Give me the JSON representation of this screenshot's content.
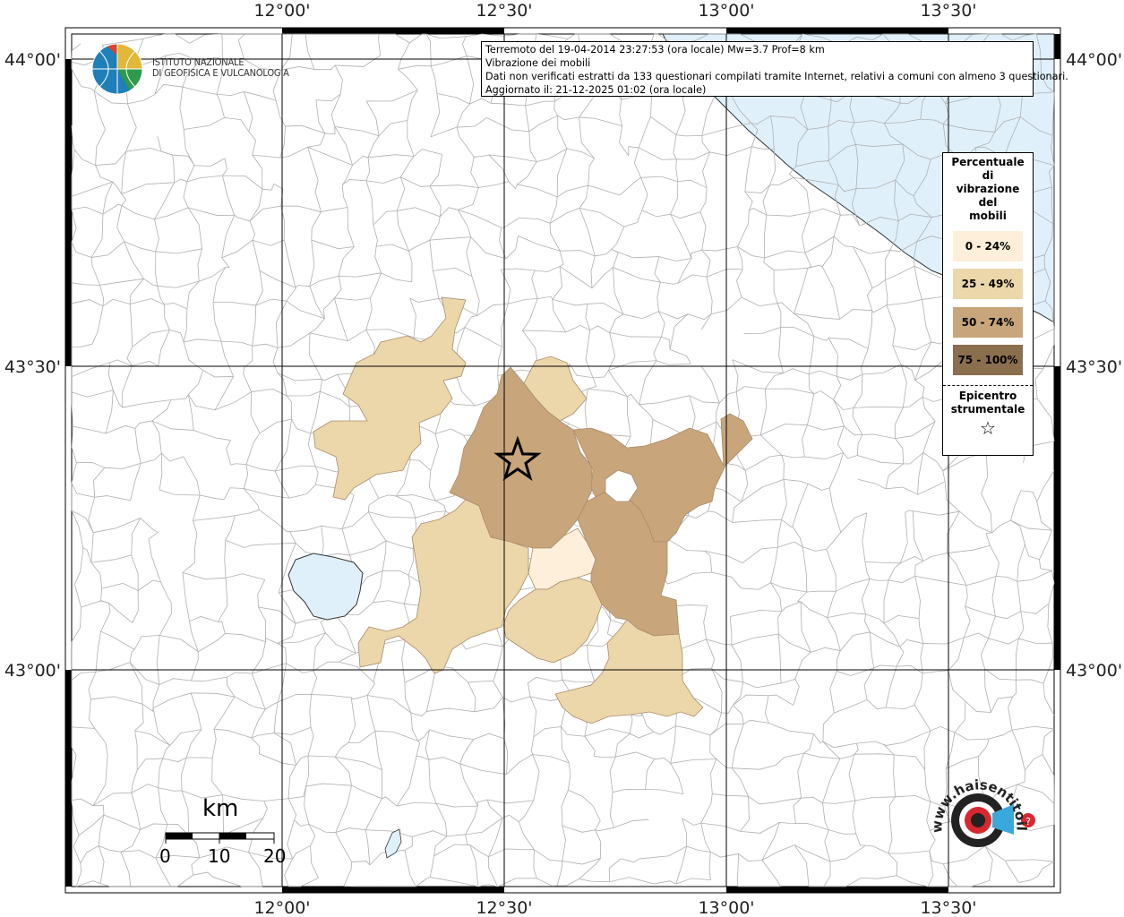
{
  "info": {
    "line1": "Terremoto del 19-04-2014 23:27:53 (ora locale) Mw=3.7 Prof=8 km",
    "line2": "Vibrazione dei mobili",
    "line3": "Dati non verificati estratti da 133 questionari compilati tramite Internet, relativi a comuni con almeno 3 questionari.",
    "line4": "Aggiornato il: 21-12-2025 01:02 (ora locale)"
  },
  "logo": {
    "line1": "ISTITUTO NAZIONALE",
    "line2": "DI GEOFISICA E VULCANOLOGIA"
  },
  "axes": {
    "lon_labels": [
      "12°00'",
      "12°30'",
      "13°00'",
      "13°30'"
    ],
    "lat_labels": [
      "44°00'",
      "43°30'",
      "43°00'"
    ]
  },
  "legend": {
    "title_lines": [
      "Percentuale",
      "di",
      "vibrazione",
      "del",
      "mobili"
    ],
    "classes": [
      {
        "label": "0 - 24%",
        "color": "#fdefd9"
      },
      {
        "label": "25 - 49%",
        "color": "#ecd7aa"
      },
      {
        "label": "50 - 74%",
        "color": "#c8a57b"
      },
      {
        "label": "75 - 100%",
        "color": "#8a6e4e"
      }
    ],
    "epicenter_lines": [
      "Epicentro",
      "strumentale"
    ],
    "epicenter_symbol": "☆"
  },
  "scale": {
    "unit": "km",
    "labels": [
      "0",
      "10",
      "20"
    ]
  },
  "watermark": {
    "text": "www.haisentitoilterremoto.it"
  },
  "colors": {
    "sea": "#dff0fb",
    "lake": "#dff0fb",
    "border": "#b0b0b0",
    "grid": "#000000"
  }
}
